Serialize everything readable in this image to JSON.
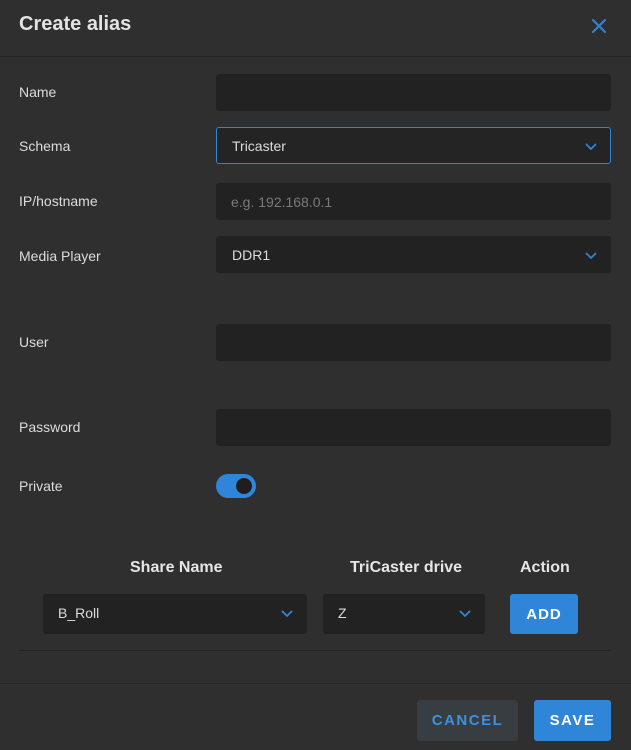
{
  "dialog": {
    "title": "Create alias"
  },
  "form": {
    "name": {
      "label": "Name",
      "value": "",
      "placeholder": ""
    },
    "schema": {
      "label": "Schema",
      "value": "Tricaster"
    },
    "ip": {
      "label": "IP/hostname",
      "value": "",
      "placeholder": "e.g. 192.168.0.1"
    },
    "media_player": {
      "label": "Media Player",
      "value": "DDR1"
    },
    "user": {
      "label": "User",
      "value": "",
      "placeholder": ""
    },
    "password": {
      "label": "Password",
      "value": "",
      "placeholder": ""
    },
    "private": {
      "label": "Private",
      "enabled": true
    }
  },
  "shares": {
    "headers": [
      "Share Name",
      "TriCaster drive",
      "Action"
    ],
    "row": {
      "share_name": "B_Roll",
      "drive": "Z",
      "action_label": "ADD"
    }
  },
  "footer": {
    "cancel_label": "CANCEL",
    "save_label": "SAVE"
  },
  "colors": {
    "accent": "#2f86d9",
    "background": "#2f2f2f",
    "field": "#222222"
  },
  "icons": {
    "close": "close-icon",
    "chevron": "chevron-down-icon",
    "toggle": "toggle-switch"
  }
}
